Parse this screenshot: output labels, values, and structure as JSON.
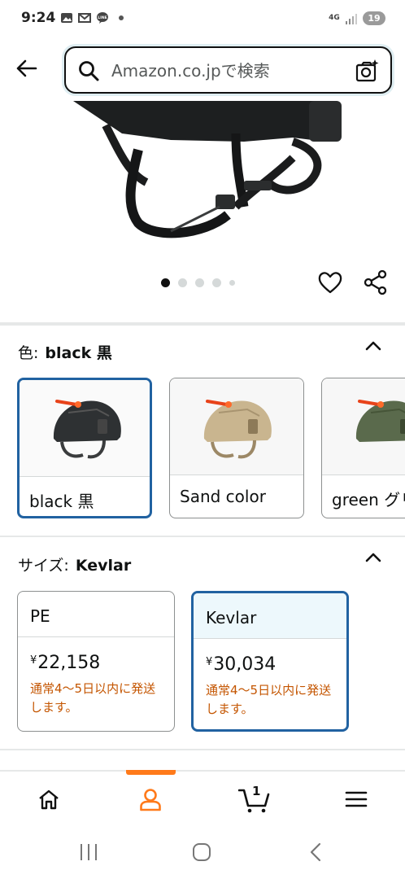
{
  "status_bar": {
    "time": "9:24",
    "network_label": "4G",
    "battery": "19",
    "icons": [
      "gallery-icon",
      "gmail-icon",
      "line-icon",
      "notification-dot-icon",
      "signal-icon",
      "battery-icon"
    ]
  },
  "header": {
    "search_placeholder": "Amazon.co.jpで検索",
    "icons": [
      "back-arrow-icon",
      "search-icon",
      "camera-search-icon"
    ]
  },
  "carousel": {
    "total_dots": 5,
    "active_index": 0,
    "actions": [
      "heart-icon",
      "share-icon"
    ]
  },
  "color_section": {
    "label": "色:",
    "selected_value": "black 黒",
    "options": [
      {
        "name": "black 黒",
        "selected": true,
        "helmet_color": "#2e3133"
      },
      {
        "name": "Sand color",
        "selected": false,
        "helmet_color": "#c9b58f"
      },
      {
        "name": "green グリ",
        "selected": false,
        "helmet_color": "#5a6a4c"
      }
    ]
  },
  "size_section": {
    "label": "サイズ:",
    "selected_value": "Kevlar",
    "options": [
      {
        "name": "PE",
        "currency": "¥",
        "price": "22,158",
        "shipping": "通常4～5日以内に発送します。",
        "selected": false
      },
      {
        "name": "Kevlar",
        "currency": "¥",
        "price": "30,034",
        "shipping": "通常4～5日以内に発送します。",
        "selected": true
      }
    ]
  },
  "bottom_nav": {
    "items": [
      "home-icon",
      "account-icon",
      "cart-icon",
      "menu-icon"
    ],
    "active": "account-icon",
    "cart_count": "1"
  },
  "system_nav": [
    "recents-icon",
    "home-circle-icon",
    "back-icon"
  ],
  "colors": {
    "accent_orange": "#ff7a1a",
    "selected_border": "#2162a1",
    "shipping_text": "#c45500"
  }
}
